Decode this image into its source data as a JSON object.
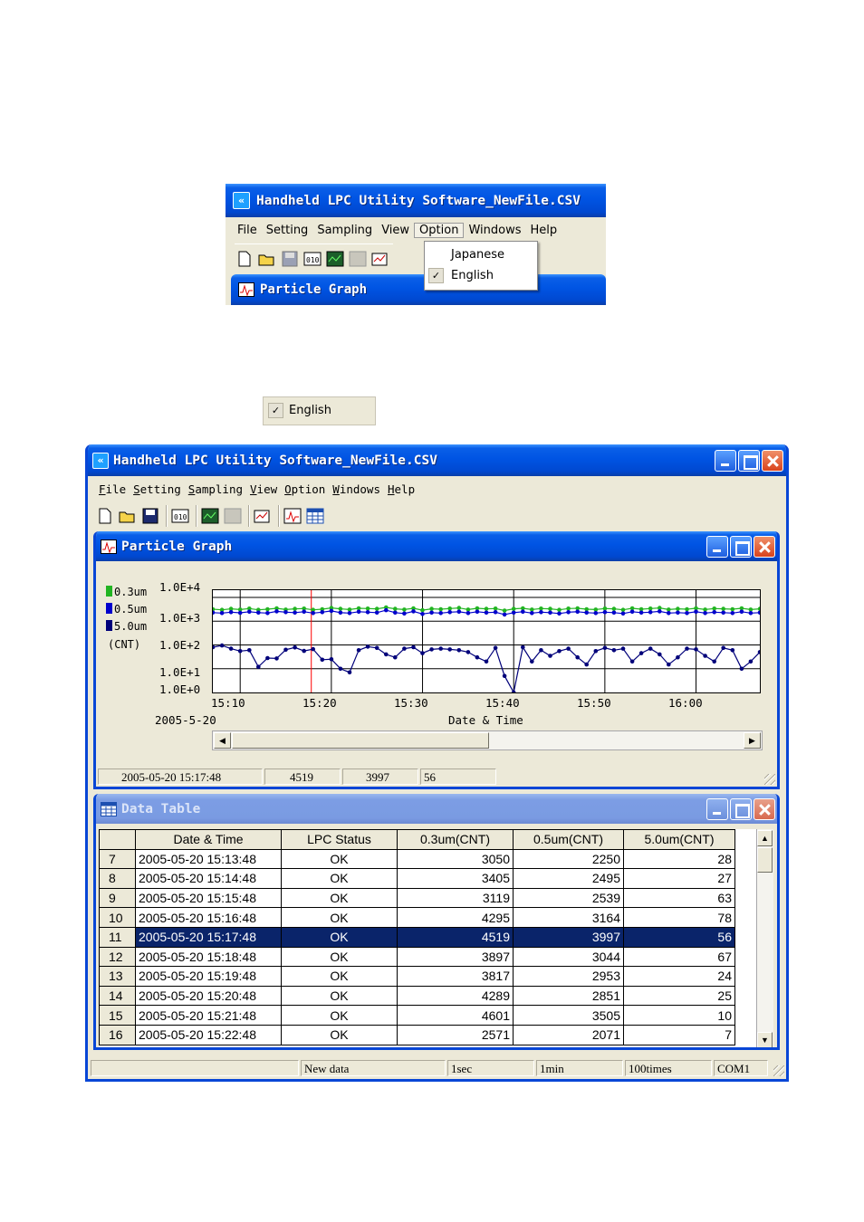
{
  "colors": {
    "xp_blue": "#0054e3",
    "series_03um": "#22b422",
    "series_05um": "#0000cc",
    "series_50um": "#00007a",
    "cursor_line": "#ff0000",
    "selection": "#0a246a"
  },
  "crop1": {
    "title": "Handheld LPC Utility Software_NewFile.CSV",
    "menus": [
      "File",
      "Setting",
      "Sampling",
      "View",
      "Option",
      "Windows",
      "Help"
    ],
    "open_menu": "Option",
    "dropdown_items": [
      {
        "label": "Japanese",
        "checked": false
      },
      {
        "label": "English",
        "checked": true
      }
    ],
    "child_title": "Particle Graph"
  },
  "english_item": {
    "label": "English",
    "checked": true
  },
  "main": {
    "title": "Handheld LPC Utility Software_NewFile.CSV",
    "menus": [
      {
        "accel": "F",
        "rest": "ile"
      },
      {
        "accel": "S",
        "rest": "etting"
      },
      {
        "accel": "S",
        "rest": "ampling"
      },
      {
        "accel": "V",
        "rest": "iew"
      },
      {
        "accel": "O",
        "rest": "ption"
      },
      {
        "accel": "W",
        "rest": "indows"
      },
      {
        "accel": "H",
        "rest": "elp"
      }
    ],
    "toolbar_icons": [
      "new-file-icon",
      "open-folder-icon",
      "save-icon",
      "binary-data-icon",
      "graph-monitor-icon",
      "disabled-monitor-icon",
      "print-chart-icon",
      "graph-window-icon",
      "table-window-icon"
    ],
    "graph_window": {
      "title": "Particle Graph",
      "legend": [
        {
          "label": "0.3um",
          "color": "#22b422"
        },
        {
          "label": "0.5um",
          "color": "#0000cc"
        },
        {
          "label": "5.0um",
          "color": "#00007a"
        }
      ],
      "unit_label": "(CNT)",
      "date_label": "2005-5-20",
      "xlabel": "Date & Time",
      "status": [
        "2005-05-20 15:17:48",
        "4519",
        "3997",
        "56"
      ]
    },
    "table_window": {
      "title": "Data Table",
      "columns": [
        "Date & Time",
        "LPC Status",
        "0.3um(CNT)",
        "0.5um(CNT)",
        "5.0um(CNT)"
      ],
      "rows": [
        {
          "n": "7",
          "dt": "2005-05-20 15:13:48",
          "status": "OK",
          "c03": "3050",
          "c05": "2250",
          "c50": "28"
        },
        {
          "n": "8",
          "dt": "2005-05-20 15:14:48",
          "status": "OK",
          "c03": "3405",
          "c05": "2495",
          "c50": "27"
        },
        {
          "n": "9",
          "dt": "2005-05-20 15:15:48",
          "status": "OK",
          "c03": "3119",
          "c05": "2539",
          "c50": "63"
        },
        {
          "n": "10",
          "dt": "2005-05-20 15:16:48",
          "status": "OK",
          "c03": "4295",
          "c05": "3164",
          "c50": "78"
        },
        {
          "n": "11",
          "dt": "2005-05-20 15:17:48",
          "status": "OK",
          "c03": "4519",
          "c05": "3997",
          "c50": "56",
          "selected": true
        },
        {
          "n": "12",
          "dt": "2005-05-20 15:18:48",
          "status": "OK",
          "c03": "3897",
          "c05": "3044",
          "c50": "67"
        },
        {
          "n": "13",
          "dt": "2005-05-20 15:19:48",
          "status": "OK",
          "c03": "3817",
          "c05": "2953",
          "c50": "24"
        },
        {
          "n": "14",
          "dt": "2005-05-20 15:20:48",
          "status": "OK",
          "c03": "4289",
          "c05": "2851",
          "c50": "25"
        },
        {
          "n": "15",
          "dt": "2005-05-20 15:21:48",
          "status": "OK",
          "c03": "4601",
          "c05": "3505",
          "c50": "10"
        },
        {
          "n": "16",
          "dt": "2005-05-20 15:22:48",
          "status": "OK",
          "c03": "2571",
          "c05": "2071",
          "c50": "7"
        }
      ]
    },
    "status_bar": [
      "New data",
      "1sec",
      "1min",
      "100times",
      "COM1"
    ]
  },
  "chart_data": {
    "type": "line",
    "scale": "log",
    "y_ticks": [
      "1.0E+4",
      "1.0E+3",
      "1.0E+2",
      "1.0E+1",
      "1.0E+0"
    ],
    "ylim": [
      1,
      10000
    ],
    "x_ticks": [
      "15:10",
      "15:20",
      "15:30",
      "15:40",
      "15:50",
      "16:00"
    ],
    "xlim": [
      "15:07",
      "16:07"
    ],
    "cursor_time": "15:17:48",
    "grid": true,
    "series": [
      {
        "name": "0.3um",
        "color": "#22b422",
        "values": [
          3200,
          3000,
          3300,
          3100,
          3400,
          3000,
          3200,
          3500,
          3100,
          3300,
          3400,
          3000,
          3200,
          3600,
          3300,
          3100,
          3500,
          3400,
          3300,
          3800,
          3300,
          3100,
          3500,
          2900,
          3300,
          3200,
          3400,
          3600,
          3100,
          3500,
          3300,
          3400,
          2800,
          3300,
          3500,
          3100,
          3400,
          3300,
          3000,
          3400,
          3500,
          3200,
          3100,
          3400,
          3300,
          3000,
          3500,
          3200,
          3400,
          3600,
          3100,
          3300,
          3200,
          3500,
          3100,
          3400,
          3300,
          3200,
          3500,
          3100,
          3300
        ]
      },
      {
        "name": "0.5um",
        "color": "#0000cc",
        "values": [
          2300,
          2200,
          2400,
          2250,
          2500,
          2300,
          2200,
          2600,
          2400,
          2300,
          2500,
          2200,
          2400,
          2700,
          2300,
          2200,
          2500,
          2400,
          2300,
          2900,
          2300,
          2100,
          2600,
          2000,
          2300,
          2200,
          2400,
          2500,
          2200,
          2500,
          2300,
          2400,
          1900,
          2300,
          2500,
          2200,
          2400,
          2300,
          2100,
          2400,
          2500,
          2300,
          2200,
          2400,
          2300,
          2100,
          2500,
          2300,
          2400,
          2600,
          2200,
          2300,
          2200,
          2500,
          2200,
          2400,
          2300,
          2200,
          2500,
          2200,
          2300
        ]
      },
      {
        "name": "5.0um",
        "color": "#00007a",
        "values": [
          80,
          95,
          70,
          55,
          60,
          12,
          28,
          27,
          63,
          78,
          56,
          67,
          24,
          25,
          10,
          7,
          60,
          85,
          75,
          40,
          30,
          70,
          80,
          45,
          65,
          70,
          65,
          60,
          50,
          30,
          20,
          75,
          5,
          1,
          80,
          20,
          60,
          35,
          55,
          70,
          30,
          15,
          55,
          75,
          60,
          70,
          20,
          45,
          70,
          40,
          15,
          30,
          70,
          65,
          35,
          20,
          75,
          60,
          10,
          20,
          50
        ]
      }
    ]
  }
}
